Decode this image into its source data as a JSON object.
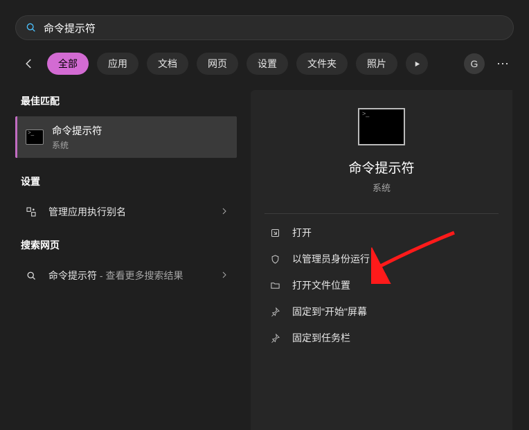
{
  "search": {
    "value": "命令提示符"
  },
  "filters": {
    "items": [
      "全部",
      "应用",
      "文档",
      "网页",
      "设置",
      "文件夹",
      "照片"
    ],
    "active_index": 0
  },
  "avatar_letter": "G",
  "left": {
    "best_match_header": "最佳匹配",
    "best_match": {
      "title": "命令提示符",
      "subtitle": "系统"
    },
    "settings_header": "设置",
    "settings_item": "管理应用执行别名",
    "web_header": "搜索网页",
    "web_item_prefix": "命令提示符",
    "web_item_suffix": " - 查看更多搜索结果"
  },
  "preview": {
    "title": "命令提示符",
    "subtitle": "系统",
    "actions": [
      "打开",
      "以管理员身份运行",
      "打开文件位置",
      "固定到\"开始\"屏幕",
      "固定到任务栏"
    ]
  }
}
